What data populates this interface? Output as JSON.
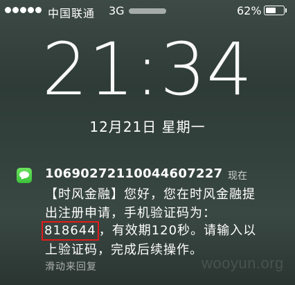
{
  "status_bar": {
    "signal_bars": 5,
    "carrier": "中国联通",
    "network": "3G",
    "battery_percent_text": "62%",
    "battery_level": 0.62
  },
  "lock_screen": {
    "time": "21:34",
    "date": "12月21日 星期一"
  },
  "notification": {
    "app_icon": "messages-icon",
    "sender": "1069027211004460 7227",
    "sender_full": "10690272110044607227",
    "time_label": "现在",
    "lines": {
      "line1": "【时风金融】您好，您在时风金融提",
      "line2": "出注册申请，手机验证码为：",
      "code": "818644",
      "line3_rest": "，有效期120秒。请输入以",
      "line4": "上验证码，完成后续操作。"
    },
    "action_hint": "滑动来回复"
  },
  "watermark": "wooyun.org",
  "colors": {
    "highlight_box": "#e41b1b",
    "icon_green": "#4cd34a"
  }
}
